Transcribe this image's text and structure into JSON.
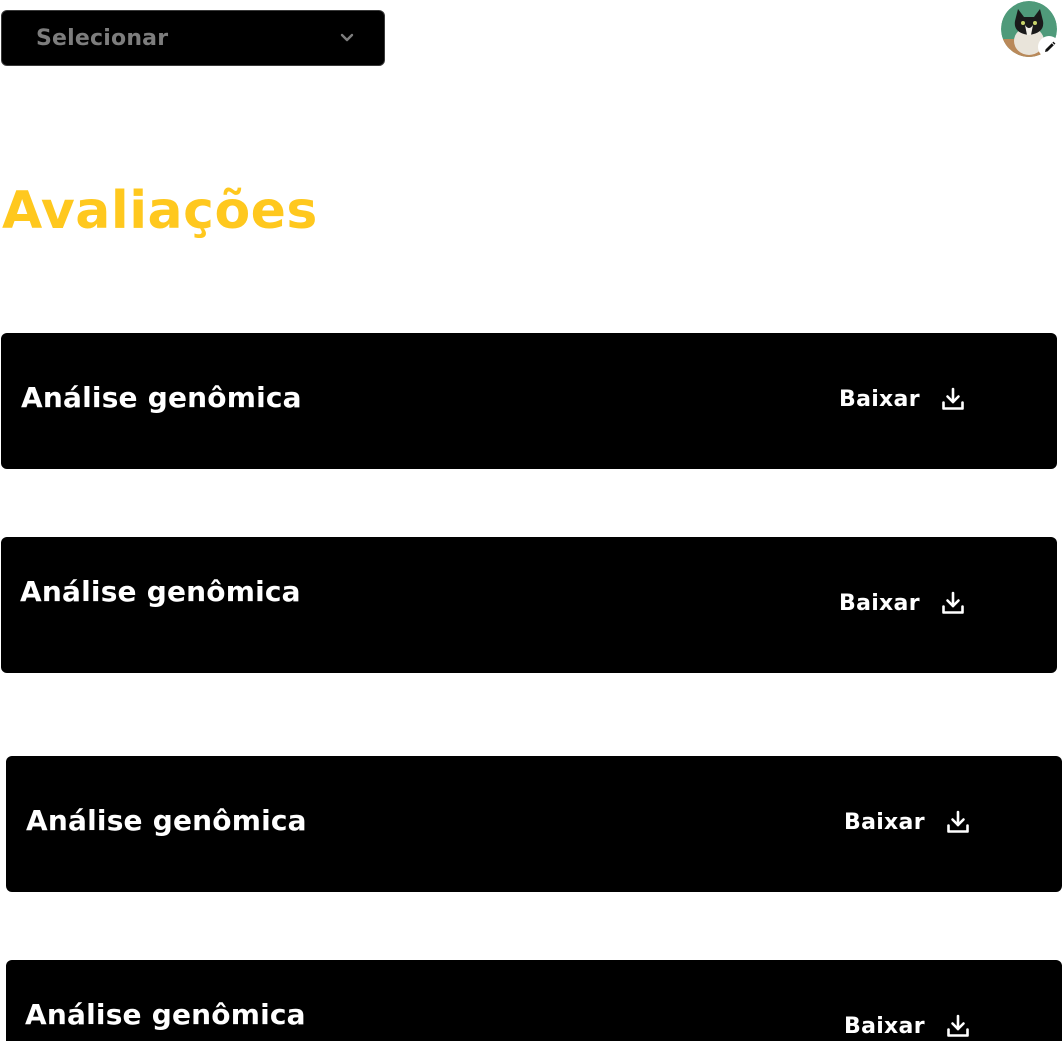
{
  "header": {
    "select": {
      "value": "Selecionar",
      "icon": "chevron-down-icon"
    },
    "avatar": {
      "icon": "avatar-photo",
      "edit_icon": "pencil-icon"
    }
  },
  "page": {
    "title": "Avaliações",
    "title_color": "#FFC81E"
  },
  "evaluations": [
    {
      "title": "Análise genômica",
      "download_label": "Baixar",
      "icon": "download-icon"
    },
    {
      "title": "Análise genômica",
      "download_label": "Baixar",
      "icon": "download-icon"
    },
    {
      "title": "Análise genômica",
      "download_label": "Baixar",
      "icon": "download-icon"
    },
    {
      "title": "Análise genômica",
      "download_label": "Baixar",
      "icon": "download-icon"
    }
  ]
}
